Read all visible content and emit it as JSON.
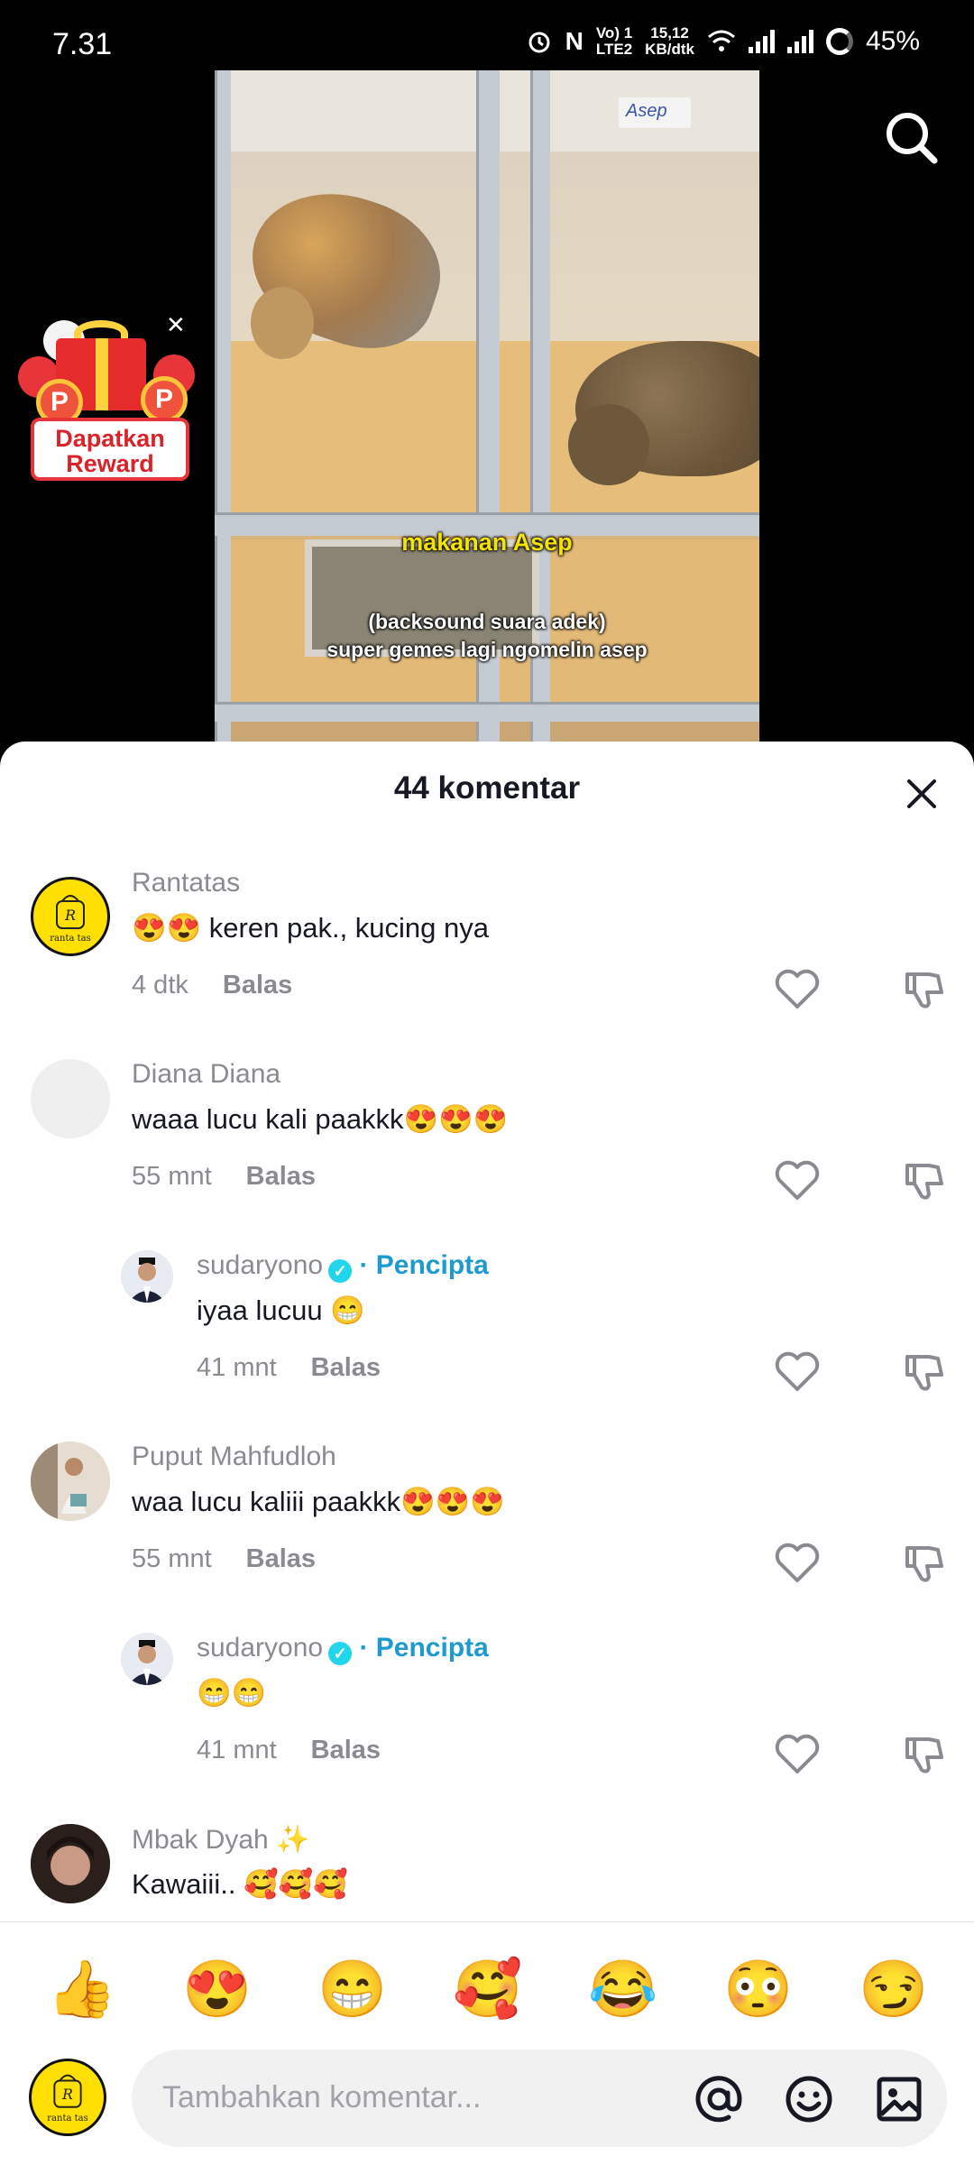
{
  "status_bar": {
    "time": "7.31",
    "network_top": "Vo) 1",
    "network_bottom": "LTE2",
    "speed_top": "15,12",
    "speed_bottom": "KB/dtk",
    "battery": "45%"
  },
  "video": {
    "name_tag": "Asep",
    "caption_1": "makanan Asep",
    "caption_2a": "(backsound suara adek)",
    "caption_2b": "super gemes lagi ngomelin asep"
  },
  "reward": {
    "label_line1": "Dapatkan",
    "label_line2": "Reward",
    "coin_letter": "P"
  },
  "sheet": {
    "title": "44 komentar"
  },
  "comments": [
    {
      "username": "Rantatas",
      "text": "😍😍 keren pak., kucing nya",
      "time": "4 dtk",
      "reply": "Balas",
      "avatar_text": "ranta tas"
    },
    {
      "username": "Diana Diana",
      "text": "waaa lucu kali paakkk😍😍😍",
      "time": "55 mnt",
      "reply": "Balas"
    },
    {
      "username": "sudaryono",
      "creator_label": "· Pencipta",
      "text": "iyaa lucuu 😁",
      "time": "41 mnt",
      "reply": "Balas"
    },
    {
      "username": "Puput Mahfudloh",
      "text": "waa lucu kaliii paakkk😍😍😍",
      "time": "55 mnt",
      "reply": "Balas"
    },
    {
      "username": "sudaryono",
      "creator_label": "· Pencipta",
      "text": "😁😁",
      "time": "41 mnt",
      "reply": "Balas"
    },
    {
      "username": "Mbak Dyah ✨",
      "text": "Kawaiii.. 🥰🥰🥰"
    }
  ],
  "emoji_bar": [
    "👍",
    "😍",
    "😁",
    "🥰",
    "😂",
    "😳",
    "😏"
  ],
  "input": {
    "placeholder": "Tambahkan komentar...",
    "avatar_text": "ranta tas"
  },
  "colors": {
    "creator": "#1d9bd1",
    "verified": "#20d5ec",
    "reward_red": "#e8353a",
    "caption_yellow": "#f5e400"
  },
  "icons": {
    "search": "search-icon",
    "close": "close-icon",
    "like": "heart-icon",
    "dislike": "thumbs-down-icon",
    "mention": "at-icon",
    "emoji": "smiley-icon",
    "image": "image-icon"
  }
}
